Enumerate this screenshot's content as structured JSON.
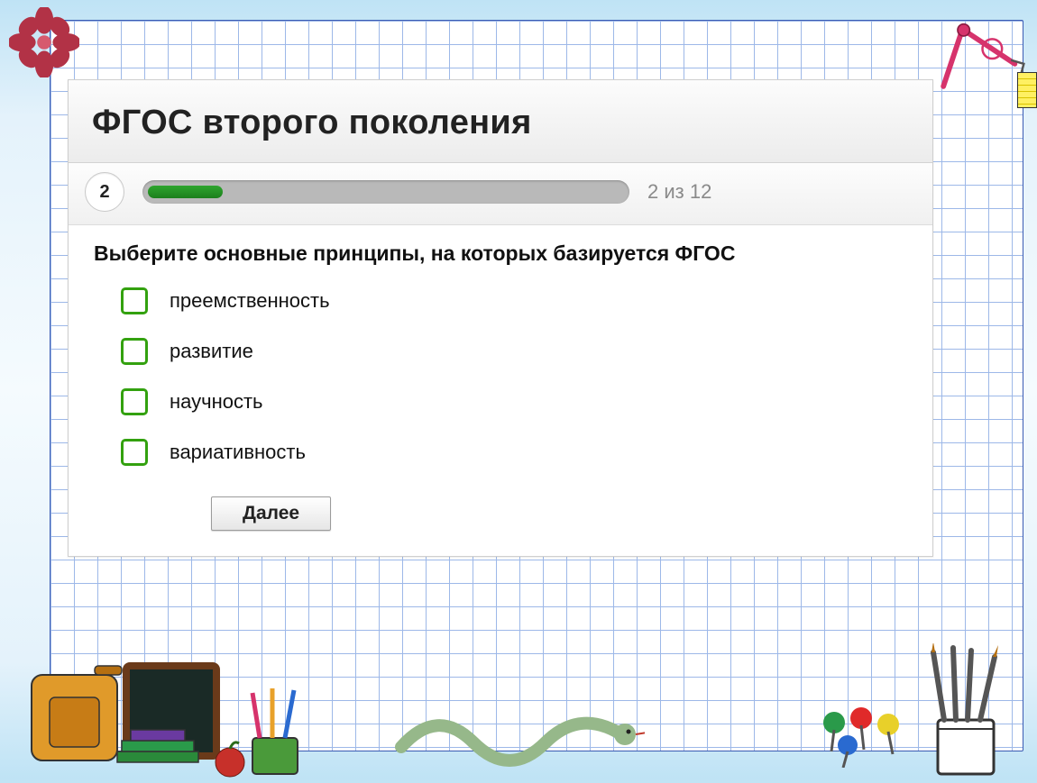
{
  "quiz": {
    "title": "ФГОС второго поколения",
    "current_number": "2",
    "progress_label": "2 из 12",
    "progress_percent": 16,
    "question": "Выберите основные принципы, на которых базируется ФГОС",
    "options": [
      {
        "label": "преемственность"
      },
      {
        "label": "развитие"
      },
      {
        "label": "научность"
      },
      {
        "label": "вариативность"
      }
    ],
    "next_label": "Далее"
  }
}
